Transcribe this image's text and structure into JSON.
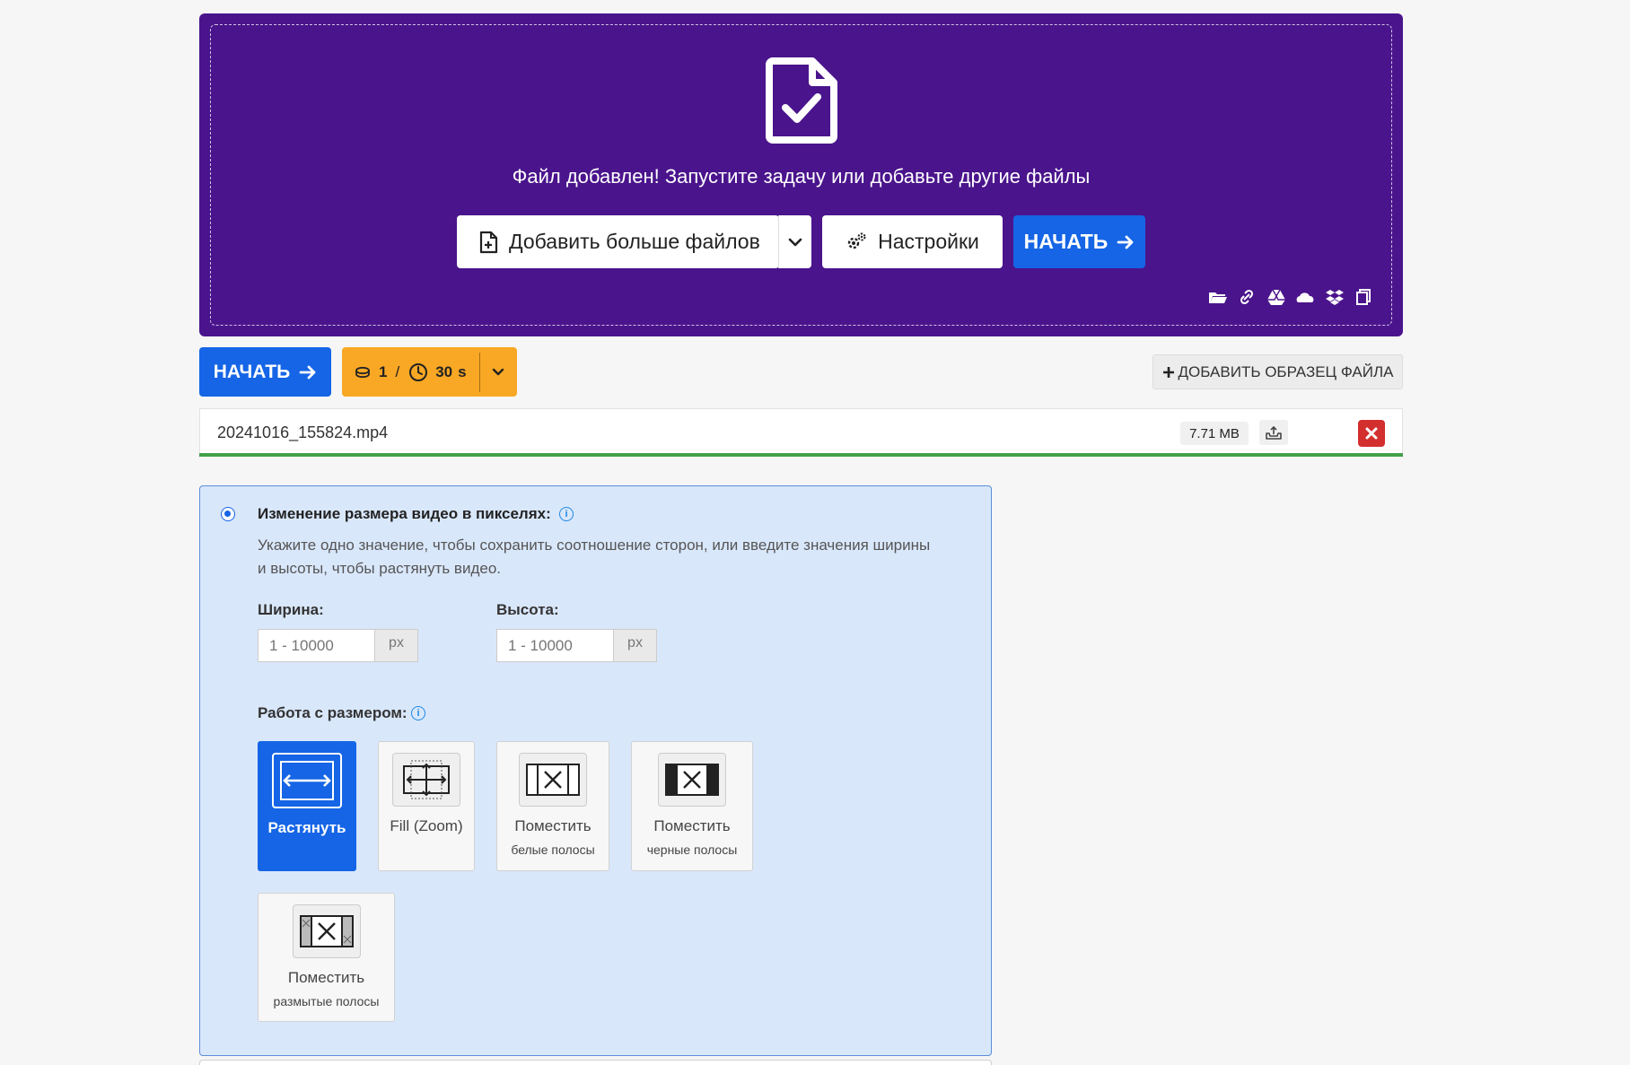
{
  "upload": {
    "message": "Файл добавлен! Запустите задачу или добавьте другие файлы",
    "add_files_label": "Добавить больше файлов",
    "settings_label": "Настройки",
    "start_label": "НАЧАТЬ",
    "bg_color": "#4a148c",
    "source_icons": [
      "folder-icon",
      "link-icon",
      "google-drive-icon",
      "onedrive-icon",
      "dropbox-icon",
      "clipboard-icon"
    ]
  },
  "actions": {
    "start_label": "НАЧАТЬ",
    "credits": {
      "count": "1",
      "slash": "/",
      "time": "30",
      "time_unit": "s"
    },
    "sample_label": "ДОБАВИТЬ ОБРАЗЕЦ ФАЙЛА"
  },
  "file": {
    "name": "20241016_155824.mp4",
    "size": "7.71 MB",
    "progress": 1.0
  },
  "options": {
    "resize_title": "Изменение размера видео в пикселях:",
    "resize_desc": "Укажите одно значение, чтобы сохранить соотношение сторон, или введите значения ширины и высоты, чтобы растянуть видео.",
    "width_label": "Ширина:",
    "height_label": "Высота:",
    "width_placeholder": "1 - 10000",
    "height_placeholder": "1 - 10000",
    "unit": "px",
    "mode_label": "Работа с размером:",
    "modes": [
      {
        "label": "Растянуть",
        "sub": "",
        "active": true
      },
      {
        "label": "Fill (Zoom)",
        "sub": ""
      },
      {
        "label": "Поместить",
        "sub": "белые полосы"
      },
      {
        "label": "Поместить",
        "sub": "черные полосы"
      },
      {
        "label": "Поместить",
        "sub": "размытые полосы"
      }
    ]
  },
  "colors": {
    "primary": "#1565e6",
    "warning": "#f9a825",
    "danger": "#d32f2f",
    "success": "#43a047",
    "panel_bg": "#d9e7fb"
  }
}
